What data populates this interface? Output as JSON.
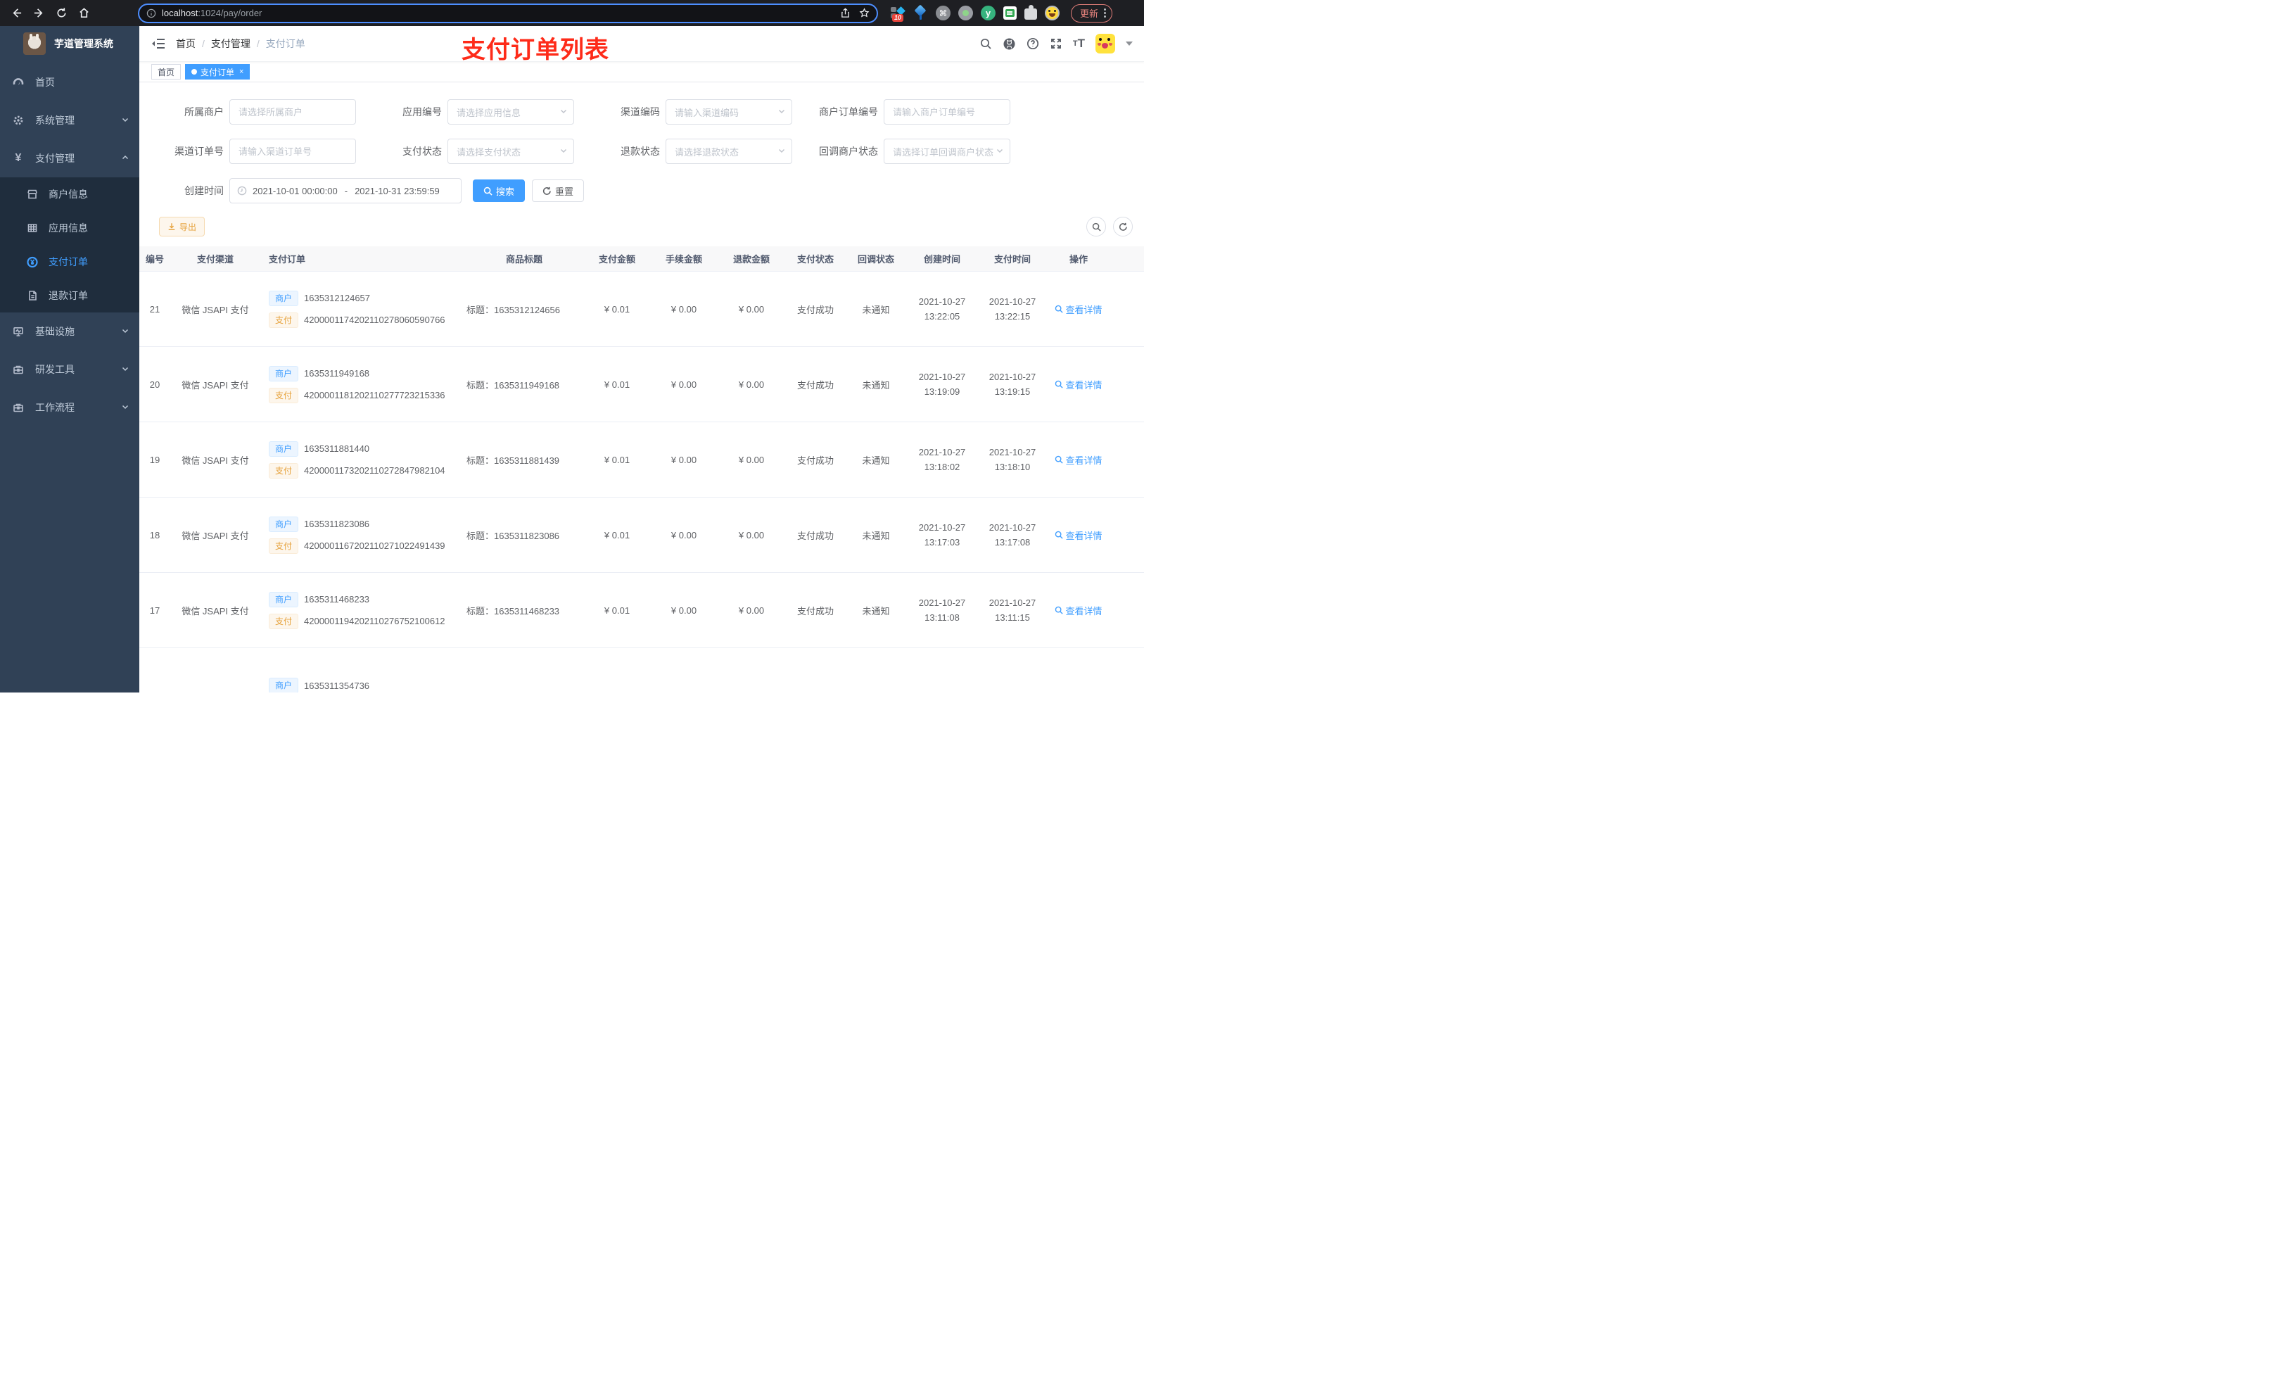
{
  "browser": {
    "url_host": "localhost",
    "url_path": ":1024/pay/order",
    "extension_badge": "10",
    "update_label": "更新",
    "icons": [
      "back-icon",
      "forward-icon",
      "reload-icon",
      "home-icon",
      "info-icon",
      "share-icon",
      "star-icon",
      "more-menu-icon"
    ]
  },
  "sidebar": {
    "app_title": "芋道管理系统",
    "menu": [
      {
        "label": "首页",
        "icon": "dashboard-icon"
      },
      {
        "label": "系统管理",
        "icon": "gear-icon"
      },
      {
        "label": "支付管理",
        "icon": "yen-icon"
      },
      {
        "label": "基础设施",
        "icon": "monitor-icon"
      },
      {
        "label": "研发工具",
        "icon": "toolbox-icon"
      },
      {
        "label": "工作流程",
        "icon": "briefcase-icon"
      }
    ],
    "submenu": [
      {
        "label": "商户信息",
        "icon": "shop-icon"
      },
      {
        "label": "应用信息",
        "icon": "grid-icon"
      },
      {
        "label": "支付订单",
        "icon": "yen-circle-icon"
      },
      {
        "label": "退款订单",
        "icon": "document-icon"
      }
    ]
  },
  "navbar": {
    "breadcrumb": {
      "home": "首页",
      "section": "支付管理",
      "current": "支付订单"
    },
    "separator": "/",
    "annotation": "支付订单列表",
    "icons": [
      "search-icon",
      "github-icon",
      "help-icon",
      "fullscreen-icon",
      "font-size-icon",
      "avatar",
      "caret-down-icon"
    ]
  },
  "tags": {
    "home": "首页",
    "active": "支付订单",
    "close": "×"
  },
  "filters": {
    "row1": [
      {
        "label": "所属商户",
        "placeholder": "请选择所属商户",
        "type": "input"
      },
      {
        "label": "应用编号",
        "placeholder": "请选择应用信息",
        "type": "select"
      },
      {
        "label": "渠道编码",
        "placeholder": "请输入渠道编码",
        "type": "select"
      },
      {
        "label": "商户订单编号",
        "placeholder": "请输入商户订单编号",
        "type": "input"
      }
    ],
    "row2": [
      {
        "label": "渠道订单号",
        "placeholder": "请输入渠道订单号",
        "type": "input"
      },
      {
        "label": "支付状态",
        "placeholder": "请选择支付状态",
        "type": "select"
      },
      {
        "label": "退款状态",
        "placeholder": "请选择退款状态",
        "type": "select"
      },
      {
        "label": "回调商户状态",
        "placeholder": "请选择订单回调商户状态",
        "type": "select"
      }
    ],
    "date_label": "创建时间",
    "date_start": "2021-10-01 00:00:00",
    "date_separator": "-",
    "date_end": "2021-10-31 23:59:59",
    "search_label": "搜索",
    "reset_label": "重置"
  },
  "toolbar": {
    "export_label": "导出"
  },
  "table": {
    "columns": [
      "编号",
      "支付渠道",
      "支付订单",
      "商品标题",
      "支付金额",
      "手续金额",
      "退款金额",
      "支付状态",
      "回调状态",
      "创建时间",
      "支付时间",
      "操作"
    ],
    "tag_merchant": "商户",
    "tag_pay": "支付",
    "rows": [
      {
        "id": "21",
        "channel": "微信 JSAPI 支付",
        "merchant_no": "1635312124657",
        "pay_no": "4200001174202110278060590766",
        "title": "标题：1635312124656",
        "pay_amount": "¥ 0.01",
        "fee_amount": "¥ 0.00",
        "refund_amount": "¥ 0.00",
        "pay_status": "支付成功",
        "notify_status": "未通知",
        "create_date": "2021-10-27",
        "create_time": "13:22:05",
        "pay_date": "2021-10-27",
        "pay_time": "13:22:15",
        "detail": "查看详情"
      },
      {
        "id": "20",
        "channel": "微信 JSAPI 支付",
        "merchant_no": "1635311949168",
        "pay_no": "4200001181202110277723215336",
        "title": "标题：1635311949168",
        "pay_amount": "¥ 0.01",
        "fee_amount": "¥ 0.00",
        "refund_amount": "¥ 0.00",
        "pay_status": "支付成功",
        "notify_status": "未通知",
        "create_date": "2021-10-27",
        "create_time": "13:19:09",
        "pay_date": "2021-10-27",
        "pay_time": "13:19:15",
        "detail": "查看详情"
      },
      {
        "id": "19",
        "channel": "微信 JSAPI 支付",
        "merchant_no": "1635311881440",
        "pay_no": "4200001173202110272847982104",
        "title": "标题：1635311881439",
        "pay_amount": "¥ 0.01",
        "fee_amount": "¥ 0.00",
        "refund_amount": "¥ 0.00",
        "pay_status": "支付成功",
        "notify_status": "未通知",
        "create_date": "2021-10-27",
        "create_time": "13:18:02",
        "pay_date": "2021-10-27",
        "pay_time": "13:18:10",
        "detail": "查看详情"
      },
      {
        "id": "18",
        "channel": "微信 JSAPI 支付",
        "merchant_no": "1635311823086",
        "pay_no": "4200001167202110271022491439",
        "title": "标题：1635311823086",
        "pay_amount": "¥ 0.01",
        "fee_amount": "¥ 0.00",
        "refund_amount": "¥ 0.00",
        "pay_status": "支付成功",
        "notify_status": "未通知",
        "create_date": "2021-10-27",
        "create_time": "13:17:03",
        "pay_date": "2021-10-27",
        "pay_time": "13:17:08",
        "detail": "查看详情"
      },
      {
        "id": "17",
        "channel": "微信 JSAPI 支付",
        "merchant_no": "1635311468233",
        "pay_no": "4200001194202110276752100612",
        "title": "标题：1635311468233",
        "pay_amount": "¥ 0.01",
        "fee_amount": "¥ 0.00",
        "refund_amount": "¥ 0.00",
        "pay_status": "支付成功",
        "notify_status": "未通知",
        "create_date": "2021-10-27",
        "create_time": "13:11:08",
        "pay_date": "2021-10-27",
        "pay_time": "13:11:15",
        "detail": "查看详情"
      },
      {
        "id": "",
        "channel": "",
        "merchant_no": "1635311354736",
        "pay_no": "",
        "title": "",
        "pay_amount": "",
        "fee_amount": "",
        "refund_amount": "",
        "pay_status": "",
        "notify_status": "",
        "create_date": "",
        "create_time": "",
        "pay_date": "",
        "pay_time": "",
        "detail": ""
      }
    ]
  },
  "colors": {
    "primary": "#409eff",
    "warning": "#e6a23c",
    "annotation_red": "#fe2b19",
    "sidebar_bg": "#304156",
    "submenu_bg": "#1f2d3d",
    "table_header_bg": "#f8f8f9"
  }
}
